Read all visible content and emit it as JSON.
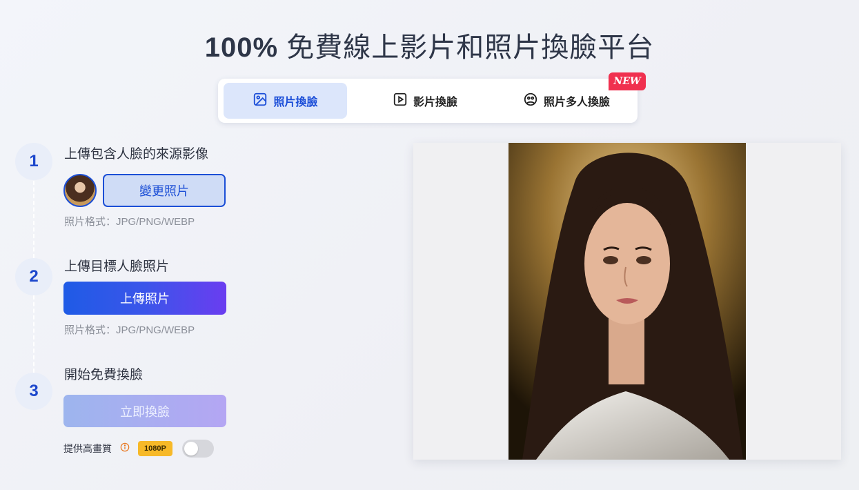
{
  "header": {
    "title_bold": "100%",
    "title_rest": " 免費線上影片和照片換臉平台"
  },
  "tabs": [
    {
      "label": "照片換臉",
      "icon": "image-icon",
      "active": true
    },
    {
      "label": "影片換臉",
      "icon": "play-icon",
      "active": false
    },
    {
      "label": "照片多人換臉",
      "icon": "multi-face-icon",
      "active": false
    }
  ],
  "new_badge": "NEW",
  "steps": [
    {
      "number": "1",
      "title": "上傳包含人臉的來源影像",
      "button": "變更照片",
      "hint": "照片格式：JPG/PNG/WEBP"
    },
    {
      "number": "2",
      "title": "上傳目標人臉照片",
      "button": "上傳照片",
      "hint": "照片格式：JPG/PNG/WEBP"
    },
    {
      "number": "3",
      "title": "開始免費換臉",
      "button": "立即換臉"
    }
  ],
  "hq": {
    "label": "提供高畫質",
    "badge": "1080P",
    "toggle_on": false
  },
  "colors": {
    "accent": "#1c4fd6",
    "new_badge": "#f0304f",
    "badge_1080": "#f7b928"
  }
}
